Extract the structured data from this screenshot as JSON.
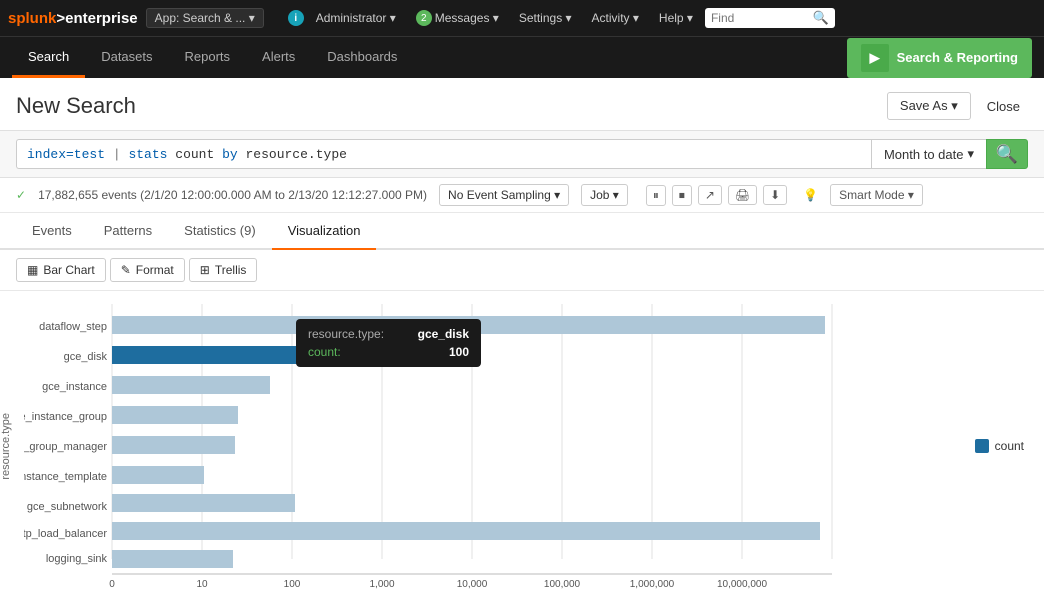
{
  "app": {
    "logo_splunk": "splunk",
    "logo_enterprise": ">enterprise",
    "app_selector_label": "App: Search & ... ▾",
    "info_icon": "ℹ",
    "admin_label": "Administrator ▾",
    "messages_count": "2",
    "messages_label": "Messages ▾",
    "settings_label": "Settings ▾",
    "activity_label": "Activity ▾",
    "help_label": "Help ▾",
    "find_placeholder": "Find"
  },
  "second_nav": {
    "tabs": [
      {
        "label": "Search",
        "active": true
      },
      {
        "label": "Datasets",
        "active": false
      },
      {
        "label": "Reports",
        "active": false
      },
      {
        "label": "Alerts",
        "active": false
      },
      {
        "label": "Dashboards",
        "active": false
      }
    ],
    "search_reporting_label": "Search & Reporting"
  },
  "page": {
    "title": "New Search",
    "save_as_label": "Save As ▾",
    "close_label": "Close"
  },
  "search": {
    "query": "index=test  |  stats count by resource.type",
    "query_index": "index=test",
    "query_pipe": "|",
    "query_cmd": "stats",
    "query_func": "count",
    "query_by": "by",
    "query_field": "resource.type",
    "time_range": "Month to date",
    "search_icon": "🔍"
  },
  "status": {
    "check_icon": "✓",
    "events_text": "17,882,655 events (2/1/20 12:00:00.000 AM to 2/13/20 12:12:27.000 PM)",
    "sampling_label": "No Event Sampling ▾",
    "job_label": "Job ▾",
    "pause_icon": "⏸",
    "stop_icon": "⏹",
    "share_icon": "↗",
    "print_icon": "🖨",
    "export_icon": "⬇",
    "bulb_icon": "💡",
    "mode_label": "Smart Mode ▾"
  },
  "view_tabs": [
    {
      "label": "Events",
      "active": false
    },
    {
      "label": "Patterns",
      "active": false
    },
    {
      "label": "Statistics (9)",
      "active": false
    },
    {
      "label": "Visualization",
      "active": true
    }
  ],
  "chart_toolbar": [
    {
      "label": "Bar Chart",
      "icon": "▦"
    },
    {
      "label": "Format",
      "icon": "✎"
    },
    {
      "label": "Trellis",
      "icon": "⊞"
    }
  ],
  "chart": {
    "y_axis_label": "resource.type",
    "x_axis_labels": [
      "0",
      "10",
      "100",
      "1,000",
      "10,000",
      "100,000",
      "1,000,000",
      "10,000,000"
    ],
    "bars": [
      {
        "label": "dataflow_step",
        "value": 9000000,
        "pct": 96
      },
      {
        "label": "gce_disk",
        "value": 100,
        "pct": 38,
        "highlighted": true
      },
      {
        "label": "gce_instance",
        "value": 35,
        "pct": 22
      },
      {
        "label": "gce_instance_group",
        "value": 17,
        "pct": 16
      },
      {
        "label": "gce_instance_group_manager",
        "value": 16,
        "pct": 15
      },
      {
        "label": "gce_instance_template",
        "value": 8,
        "pct": 10
      },
      {
        "label": "gce_subnetwork",
        "value": 60,
        "pct": 26
      },
      {
        "label": "http_load_balancer",
        "value": 8000000,
        "pct": 88
      },
      {
        "label": "logging_sink",
        "value": 15,
        "pct": 12
      }
    ],
    "tooltip": {
      "key_label": "resource.type:",
      "key_value": "gce_disk",
      "count_label": "count:",
      "count_value": "100"
    },
    "legend_label": "count",
    "legend_color": "#1e6d9f"
  }
}
